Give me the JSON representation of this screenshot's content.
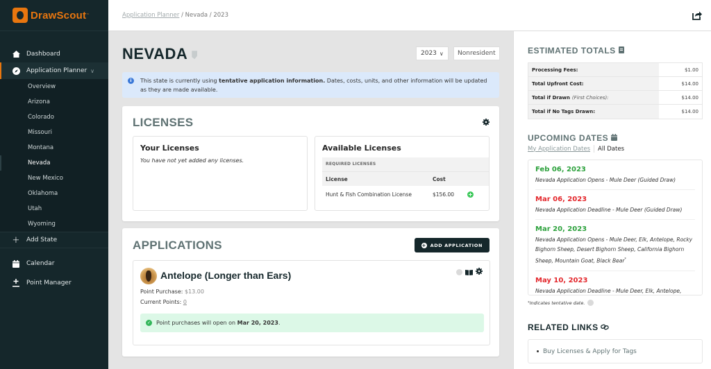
{
  "brand": {
    "name": "DrawScout",
    "tm": "™",
    "accent": "#e8760f"
  },
  "sidebar": {
    "items": [
      {
        "label": "Dashboard",
        "icon": "home-icon"
      },
      {
        "label": "Application Planner",
        "icon": "compass-icon",
        "expanded": true
      }
    ],
    "sub_items": [
      "Overview",
      "Arizona",
      "Colorado",
      "Missouri",
      "Montana",
      "Nevada",
      "New Mexico",
      "Oklahoma",
      "Utah",
      "Wyoming"
    ],
    "current_sub": "Nevada",
    "add_state": "Add State",
    "bottom_items": [
      {
        "label": "Calendar",
        "icon": "calendar-icon"
      },
      {
        "label": "Point Manager",
        "icon": "plus-minus-icon"
      }
    ]
  },
  "breadcrumb": {
    "link": "Application Planner",
    "rest": " / Nevada / 2023"
  },
  "page": {
    "title": "NEVADA",
    "year": "2023",
    "residency": "Nonresident",
    "info_alert": {
      "pre": "This state is currently using ",
      "bold": "tentative application information.",
      "post": " Dates, costs, units, and other information will be updated as they are made available."
    }
  },
  "licenses": {
    "title": "LICENSES",
    "your": {
      "title": "Your Licenses",
      "empty": "You have not yet added any licenses."
    },
    "available": {
      "title": "Available Licenses",
      "group": "REQUIRED LICENSES",
      "columns": [
        "License",
        "Cost"
      ],
      "rows": [
        {
          "license": "Hunt & Fish Combination License",
          "cost": "$156.00"
        }
      ]
    }
  },
  "applications": {
    "title": "APPLICATIONS",
    "add_button": "ADD APPLICATION",
    "items": [
      {
        "title": "Antelope (Longer than Ears)",
        "point_purchase_label": "Point Purchase: ",
        "point_purchase": "$13.00",
        "current_points_label": "Current Points: ",
        "current_points": "0",
        "notice_pre": "Point purchases will open on ",
        "notice_bold": "Mar 20, 2023",
        "notice_post": "."
      }
    ]
  },
  "totals": {
    "title": "ESTIMATED TOTALS",
    "rows": [
      {
        "label": "Processing Fees:",
        "note": "",
        "value": "$1.00"
      },
      {
        "label": "Total Upfront Cost:",
        "note": "",
        "value": "$14.00"
      },
      {
        "label": "Total if Drawn",
        "note": "(First Choices):",
        "value": "$14.00"
      },
      {
        "label": "Total if No Tags Drawn:",
        "note": "",
        "value": "$14.00"
      }
    ]
  },
  "upcoming": {
    "title": "UPCOMING DATES",
    "tabs": [
      "My Application Dates",
      "All Dates"
    ],
    "active_tab": "All Dates",
    "items": [
      {
        "date": "Feb 06, 2023",
        "color": "green",
        "desc": "Nevada Application Opens - Mule Deer (Guided Draw)",
        "tentative": false
      },
      {
        "date": "Mar 06, 2023",
        "color": "red",
        "desc": "Nevada Application Deadline - Mule Deer (Guided Draw)",
        "tentative": false
      },
      {
        "date": "Mar 20, 2023",
        "color": "green",
        "desc": "Nevada Application Opens - Mule Deer, Elk, Antelope, Rocky Bighorn Sheep, Desert Bighorn Sheep, California Bighorn Sheep, Mountain Goat, Black Bear",
        "tentative": true
      },
      {
        "date": "May 10, 2023",
        "color": "red",
        "desc": "Nevada Application Deadline - Mule Deer, Elk, Antelope, Rocky Bighorn Sheep, Desert Bighorn Sheep",
        "tentative": false
      }
    ],
    "note_mark": "*",
    "note": "Indicates tentative date."
  },
  "related": {
    "title": "RELATED LINKS",
    "links": [
      "Buy Licenses & Apply for Tags"
    ]
  }
}
